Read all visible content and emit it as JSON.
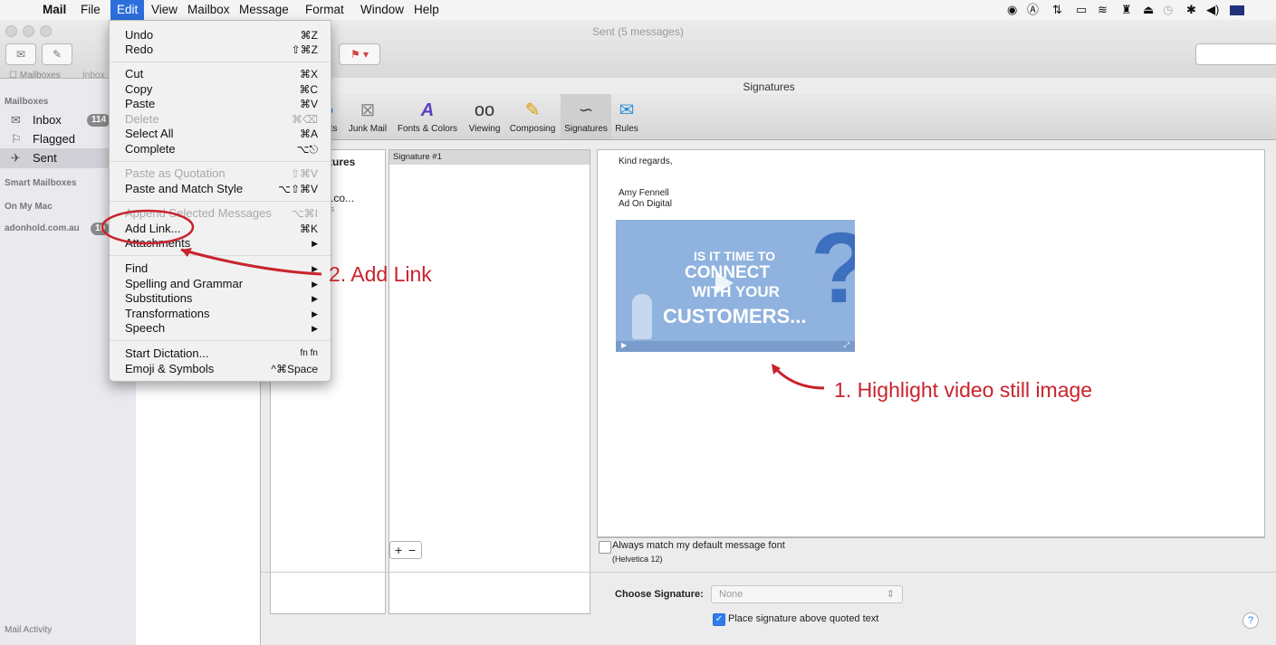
{
  "menubar": {
    "apple": "",
    "app": "Mail",
    "items": [
      "File",
      "Edit",
      "View",
      "Mailbox",
      "Message",
      "Format",
      "Window",
      "Help"
    ],
    "active": "Edit"
  },
  "window": {
    "title": "Sent (5 messages)",
    "favorites": [
      "Mailboxes",
      "Inbox"
    ]
  },
  "sidebar": {
    "header_mailboxes": "Mailboxes",
    "inbox": {
      "label": "Inbox",
      "count": "114"
    },
    "flagged": "Flagged",
    "sent": "Sent",
    "smart": "Smart Mailboxes",
    "onmymac": "On My Mac",
    "account": {
      "label": "adonhold.com.au",
      "count": "10"
    },
    "activity": "Mail Activity"
  },
  "prefs": {
    "title": "Signatures",
    "toolbar": [
      {
        "label": "unts",
        "icon": "accounts-icon"
      },
      {
        "label": "Junk Mail",
        "icon": "junk-mail-icon"
      },
      {
        "label": "Fonts & Colors",
        "icon": "fonts-colors-icon"
      },
      {
        "label": "Viewing",
        "icon": "viewing-icon"
      },
      {
        "label": "Composing",
        "icon": "composing-icon"
      },
      {
        "label": "Signatures",
        "icon": "signatures-icon"
      },
      {
        "label": "Rules",
        "icon": "rules-icon"
      }
    ],
    "accounts_pane": {
      "all": "natures",
      "all_sub": "ture",
      "acct": "old.co...",
      "acct_sub": "tures"
    },
    "signature_name": "Signature #1",
    "signature_text": [
      "Kind regards,",
      "Amy Fennell",
      "Ad On Digital"
    ],
    "video": {
      "line1": "IS IT TIME TO",
      "line2": "CONNECT",
      "line3": "WITH YOUR",
      "line4": "CUSTOMERS..."
    },
    "plus": "+",
    "minus": "−",
    "match_font": "Always match my default message font",
    "match_font_sub": "(Helvetica 12)",
    "choose_label": "Choose Signature:",
    "choose_value": "None",
    "place_above": "Place signature above quoted text",
    "help": "?"
  },
  "edit_menu": {
    "items": [
      {
        "label": "Undo",
        "sc": "⌘Z"
      },
      {
        "label": "Redo",
        "sc": "⇧⌘Z"
      },
      {
        "label": "Cut",
        "sc": "⌘X"
      },
      {
        "label": "Copy",
        "sc": "⌘C"
      },
      {
        "label": "Paste",
        "sc": "⌘V"
      },
      {
        "label": "Delete",
        "sc": "⌘⌫"
      },
      {
        "label": "Select All",
        "sc": "⌘A"
      },
      {
        "label": "Complete",
        "sc": "⌥⎋"
      },
      {
        "label": "Paste as Quotation",
        "sc": "⇧⌘V"
      },
      {
        "label": "Paste and Match Style",
        "sc": "⌥⇧⌘V"
      },
      {
        "label": "Append Selected Messages",
        "sc": "⌥⌘I"
      },
      {
        "label": "Add Link...",
        "sc": "⌘K"
      },
      {
        "label": "Attachments",
        "sc": "▶"
      },
      {
        "label": "Find",
        "sc": "▶"
      },
      {
        "label": "Spelling and Grammar",
        "sc": "▶"
      },
      {
        "label": "Substitutions",
        "sc": "▶"
      },
      {
        "label": "Transformations",
        "sc": "▶"
      },
      {
        "label": "Speech",
        "sc": "▶"
      },
      {
        "label": "Start Dictation...",
        "sc": "fn fn"
      },
      {
        "label": "Emoji & Symbols",
        "sc": "^⌘Space"
      }
    ]
  },
  "annotations": {
    "step1": "1. Highlight video still image",
    "step2": "2. Add Link"
  },
  "colors": {
    "accent": "#2c6fdc",
    "annotation": "#c8232c"
  }
}
